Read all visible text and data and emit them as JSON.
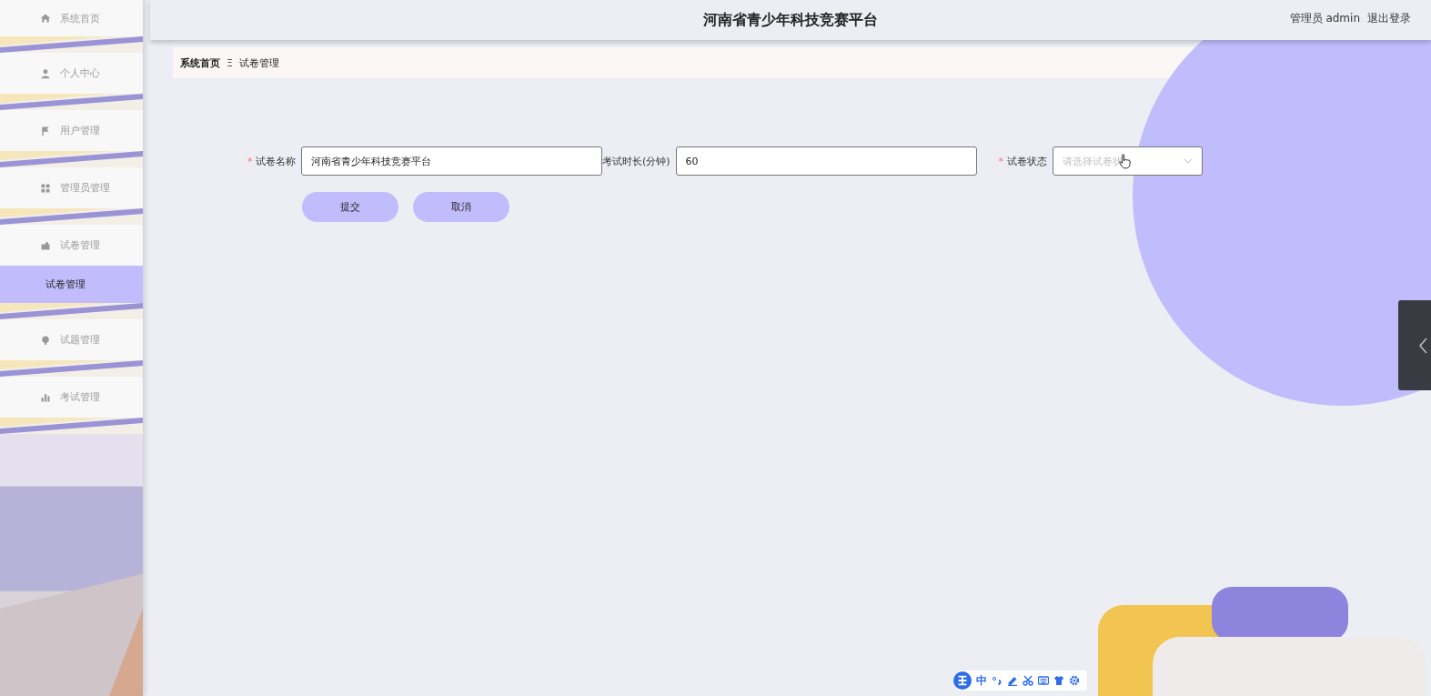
{
  "sidebar": {
    "items": [
      {
        "label": "系统首页",
        "kind": "menu",
        "selected": false
      },
      {
        "label": "个人中心",
        "kind": "menu",
        "selected": false
      },
      {
        "label": "用户管理",
        "kind": "menu",
        "selected": false
      },
      {
        "label": "管理员管理",
        "kind": "menu",
        "selected": false
      },
      {
        "label": "试卷管理",
        "kind": "menu",
        "selected": false
      },
      {
        "label": "试卷管理",
        "kind": "submenu",
        "selected": true
      },
      {
        "label": "试题管理",
        "kind": "menu",
        "selected": false
      },
      {
        "label": "考试管理",
        "kind": "menu",
        "selected": false
      }
    ]
  },
  "header": {
    "title": "河南省青少年科技竞赛平台",
    "user": "管理员 admin",
    "logout": "退出登录"
  },
  "breadcrumb": {
    "items": [
      "系统首页",
      "试卷管理"
    ],
    "separator": "Ξ"
  },
  "form": {
    "fields": [
      {
        "label": "试卷名称",
        "required_mark": "*",
        "kind": "text",
        "value": "河南省青少年科技竞赛平台"
      },
      {
        "label": "考试时长(分钟)",
        "kind": "text",
        "value": "60"
      },
      {
        "label": "试卷状态",
        "required_mark": "*",
        "kind": "select",
        "placeholder": "请选择试卷状"
      }
    ],
    "buttons": [
      "提交",
      "取消"
    ]
  },
  "ime_toolbar": {
    "mode": "中"
  }
}
